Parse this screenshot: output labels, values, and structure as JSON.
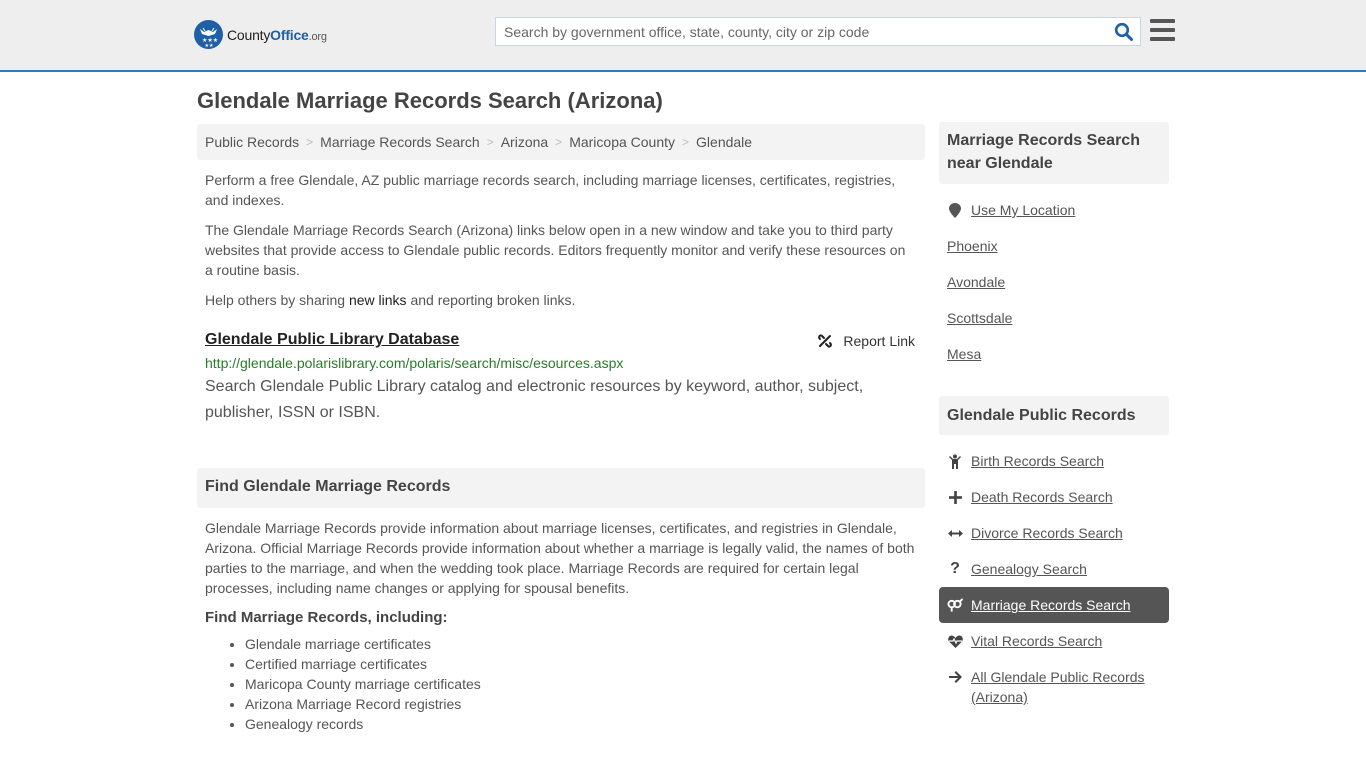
{
  "header": {
    "logo": {
      "county": "County",
      "office": "Office",
      "org": ".org"
    },
    "search": {
      "placeholder": "Search by government office, state, county, city or zip code",
      "value": ""
    },
    "icons": {
      "search": "search-icon",
      "menu": "hamburger-menu-icon"
    }
  },
  "page": {
    "title": "Glendale Marriage Records Search (Arizona)"
  },
  "breadcrumb": [
    {
      "label": "Public Records"
    },
    {
      "label": "Marriage Records Search"
    },
    {
      "label": "Arizona"
    },
    {
      "label": "Maricopa County"
    },
    {
      "label": "Glendale"
    }
  ],
  "intro": {
    "p1": "Perform a free Glendale, AZ public marriage records search, including marriage licenses, certificates, registries, and indexes.",
    "p2": "The Glendale Marriage Records Search (Arizona) links below open in a new window and take you to third party websites that provide access to Glendale public records. Editors frequently monitor and verify these resources on a routine basis.",
    "p3_before": "Help others by sharing ",
    "p3_link": "new links",
    "p3_after": " and reporting broken links."
  },
  "results": [
    {
      "title": "Glendale Public Library Database",
      "url": "http://glendale.polarislibrary.com/polaris/search/misc/esources.aspx",
      "description": "Search Glendale Public Library catalog and electronic resources by keyword, author, subject, publisher, ISSN or ISBN.",
      "report_label": "Report Link"
    }
  ],
  "find_section": {
    "heading": "Find Glendale Marriage Records",
    "paragraph": "Glendale Marriage Records provide information about marriage licenses, certificates, and registries in Glendale, Arizona. Official Marriage Records provide information about whether a marriage is legally valid, the names of both parties to the marriage, and when the wedding took place. Marriage Records are required for certain legal processes, including name changes or applying for spousal benefits.",
    "subheading": "Find Marriage Records, including:",
    "items": [
      "Glendale marriage certificates",
      "Certified marriage certificates",
      "Maricopa County marriage certificates",
      "Arizona Marriage Record registries",
      "Genealogy records"
    ]
  },
  "sidebar": {
    "near_heading": "Marriage Records Search near Glendale",
    "use_location": "Use My Location",
    "nearby": [
      "Phoenix",
      "Avondale",
      "Scottsdale",
      "Mesa"
    ],
    "records_heading": "Glendale Public Records",
    "records": [
      {
        "label": "Birth Records Search",
        "icon": "child-icon",
        "active": false
      },
      {
        "label": "Death Records Search",
        "icon": "cross-icon",
        "active": false
      },
      {
        "label": "Divorce Records Search",
        "icon": "arrows-horizontal-icon",
        "active": false
      },
      {
        "label": "Genealogy Search",
        "icon": "question-icon",
        "active": false
      },
      {
        "label": "Marriage Records Search",
        "icon": "gender-rings-icon",
        "active": true
      },
      {
        "label": "Vital Records Search",
        "icon": "heartbeat-icon",
        "active": false
      },
      {
        "label": "All Glendale Public Records (Arizona)",
        "icon": "arrow-right-icon",
        "active": false
      }
    ]
  },
  "colors": {
    "brand_blue": "#1f5fa6",
    "header_border": "#2f7ab9",
    "url_green": "#2b7a2b",
    "active_bg": "#555555"
  }
}
